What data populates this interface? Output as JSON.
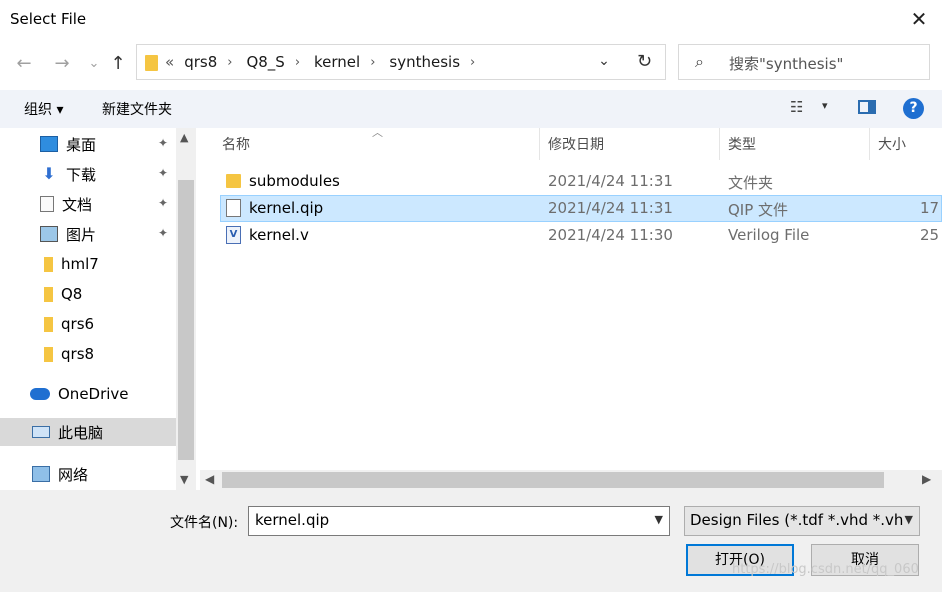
{
  "window": {
    "title": "Select File",
    "close_glyph": "✕"
  },
  "nav_buttons": {
    "back": "←",
    "forward": "→",
    "recent": "⌄",
    "up": "↑"
  },
  "address": {
    "overflow": "«",
    "crumbs": [
      "qrs8",
      "Q8_S",
      "kernel",
      "synthesis"
    ],
    "separator": "›",
    "dropdown": "⌄",
    "refresh": "↻"
  },
  "search": {
    "icon": "⌕",
    "placeholder": "搜索\"synthesis\""
  },
  "toolbar": {
    "organize": "组织 ▾",
    "new_folder": "新建文件夹",
    "view_icon": "☷",
    "view_dd": "▾",
    "help": "?"
  },
  "sidebar": {
    "items": [
      {
        "label": "桌面",
        "icon": "desktop-icon",
        "pinned": true
      },
      {
        "label": "下载",
        "icon": "download-icon",
        "pinned": true
      },
      {
        "label": "文档",
        "icon": "document-icon",
        "pinned": true
      },
      {
        "label": "图片",
        "icon": "pictures-icon",
        "pinned": true
      },
      {
        "label": "hml7",
        "icon": "folder-icon",
        "pinned": false
      },
      {
        "label": "Q8",
        "icon": "folder-icon",
        "pinned": false
      },
      {
        "label": "qrs6",
        "icon": "folder-icon",
        "pinned": false
      },
      {
        "label": "qrs8",
        "icon": "folder-icon",
        "pinned": false
      },
      {
        "label": "OneDrive",
        "icon": "onedrive-icon",
        "pinned": false
      },
      {
        "label": "此电脑",
        "icon": "computer-icon",
        "pinned": false,
        "selected": true
      },
      {
        "label": "网络",
        "icon": "network-icon",
        "pinned": false
      }
    ],
    "pin_glyph": "📌"
  },
  "file_list": {
    "columns": [
      "名称",
      "修改日期",
      "类型",
      "大小"
    ],
    "rows": [
      {
        "name": "submodules",
        "date": "2021/4/24 11:31",
        "type": "文件夹",
        "size": "",
        "icon": "folder-icon"
      },
      {
        "name": "kernel.qip",
        "date": "2021/4/24 11:31",
        "type": "QIP 文件",
        "size": "17",
        "icon": "file-icon",
        "selected": true
      },
      {
        "name": "kernel.v",
        "date": "2021/4/24 11:30",
        "type": "Verilog File",
        "size": "25",
        "icon": "verilog-file-icon"
      }
    ]
  },
  "bottom": {
    "filename_label": "文件名(N):",
    "filename_value": "kernel.qip",
    "filter_value": "Design Files (*.tdf *.vhd *.vhd",
    "open_label": "打开(O)",
    "cancel_label": "取消",
    "watermark": "https://blog.csdn.net/qq_060"
  },
  "colors": {
    "selection_bg": "#cce8ff",
    "selection_border": "#99d1ff",
    "toolbar_bg": "#f0f3f9",
    "accent": "#0078d7"
  }
}
